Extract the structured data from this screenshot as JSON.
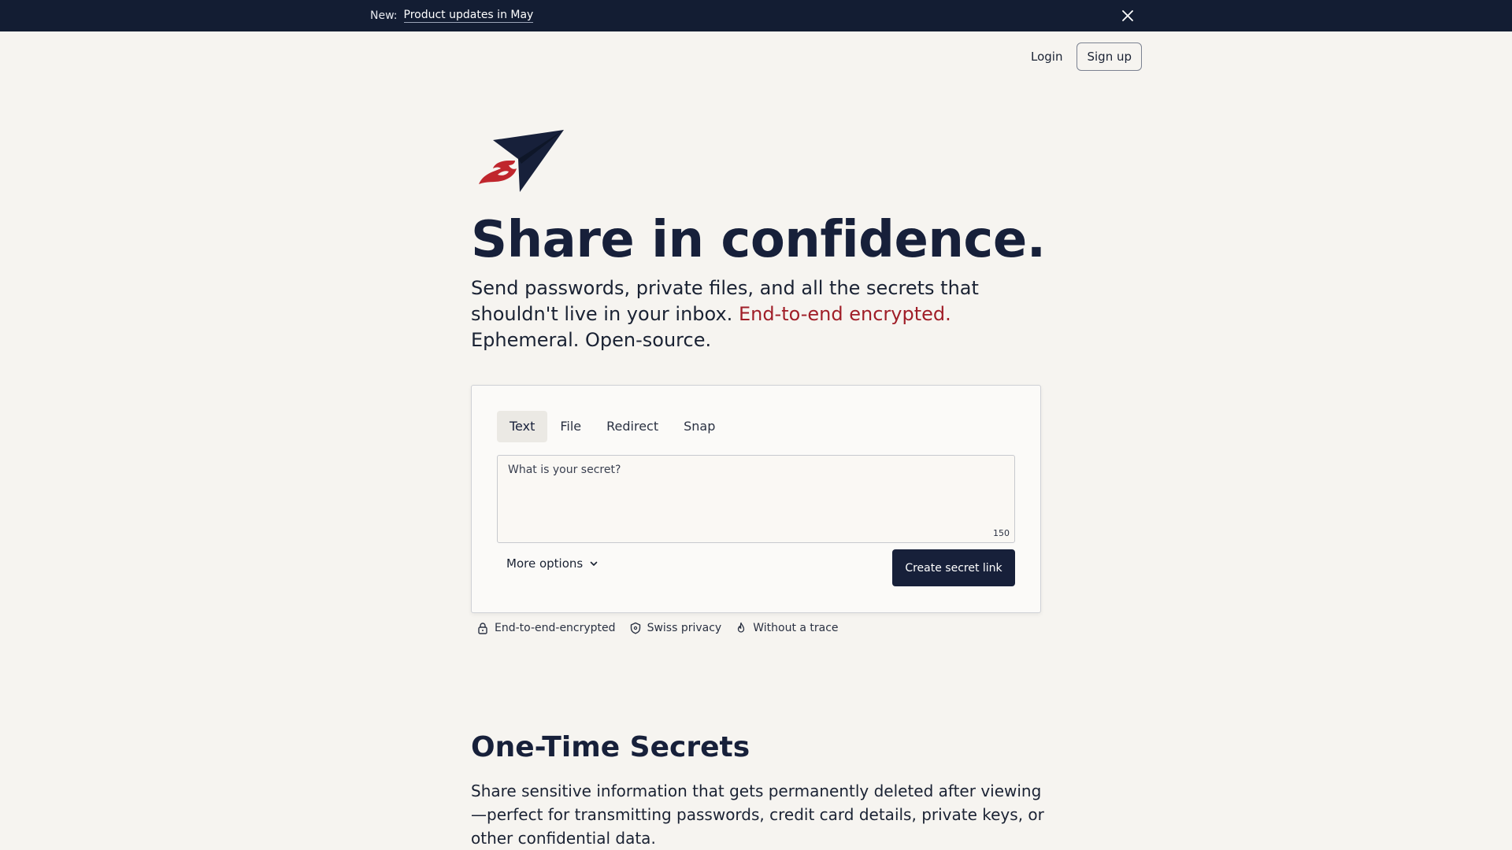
{
  "banner": {
    "prefix": "New:",
    "link_text": "Product updates in May",
    "close_icon": "close-icon"
  },
  "nav": {
    "login_label": "Login",
    "signup_label": "Sign up"
  },
  "logo": {
    "icon": "paper-plane-flame-logo",
    "colors": {
      "plane": "#17203a",
      "flame": "#c0262d"
    }
  },
  "hero": {
    "title": "Share in confidence.",
    "subtitle_part1": "Send passwords, private files, and all the secrets that shouldn't live in your inbox.",
    "subtitle_accent": "End-to-end encrypted.",
    "subtitle_part2": "Ephemeral. Open-source."
  },
  "composer": {
    "tabs": [
      {
        "label": "Text",
        "active": true
      },
      {
        "label": "File",
        "active": false
      },
      {
        "label": "Redirect",
        "active": false
      },
      {
        "label": "Snap",
        "active": false
      }
    ],
    "secret_placeholder": "What is your secret?",
    "secret_value": "",
    "char_count": "150",
    "more_options_label": "More options",
    "more_options_icon": "chevron-down-icon",
    "create_label": "Create secret link"
  },
  "features": [
    {
      "icon": "lock-icon",
      "label": "End-to-end-encrypted"
    },
    {
      "icon": "shield-icon",
      "label": "Swiss privacy"
    },
    {
      "icon": "flame-icon",
      "label": "Without a trace"
    }
  ],
  "section": {
    "title": "One-Time Secrets",
    "text": "Share sensitive information that gets permanently deleted after viewing—perfect for transmitting passwords, credit card details, private keys, or other confidential data."
  },
  "colors": {
    "background": "#f6f4f0",
    "banner": "#131d33",
    "primary": "#17203a",
    "accent": "#a01e28"
  }
}
